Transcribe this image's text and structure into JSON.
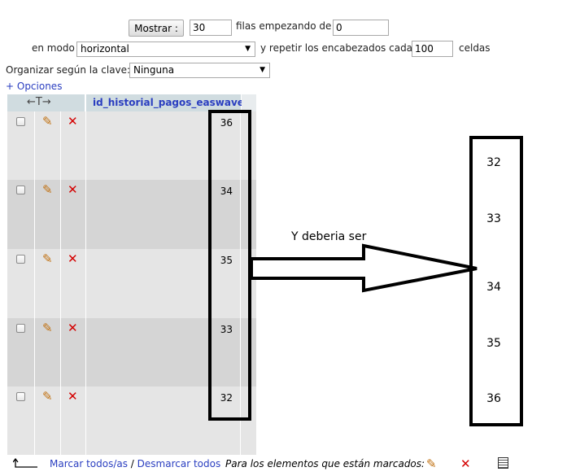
{
  "toolbar": {
    "mostrar_label": "Mostrar :",
    "rows_value": "30",
    "rows_text": "filas empezando de",
    "start_value": "0",
    "modo_text": "en modo",
    "modo_value": "horizontal",
    "repetir_text": "y repetir los encabezados cada",
    "repetir_value": "100",
    "celdas_text": "celdas",
    "organizar_text": "Organizar según la clave:",
    "organizar_value": "Ninguna",
    "opciones_link": "+ Opciones"
  },
  "table": {
    "column_header": "id_historial_pagos_easwave",
    "sort_arrows": "←T→",
    "rows": [
      {
        "value": "36"
      },
      {
        "value": "34"
      },
      {
        "value": "35"
      },
      {
        "value": "33"
      },
      {
        "value": "32"
      }
    ]
  },
  "annotation": {
    "arrow_text": "Y deberia ser",
    "expected_values": [
      "32",
      "33",
      "34",
      "35",
      "36"
    ]
  },
  "footer": {
    "marcar_todos": "Marcar todos/as",
    "separator": " / ",
    "desmarcar_todos": "Desmarcar todos",
    "para_text": "Para los elementos que están marcados:"
  },
  "colors": {
    "header_bg": "#d0dce0",
    "row_light": "#e5e5e5",
    "row_dark": "#d5d5d5",
    "link": "#2a3ec0"
  }
}
